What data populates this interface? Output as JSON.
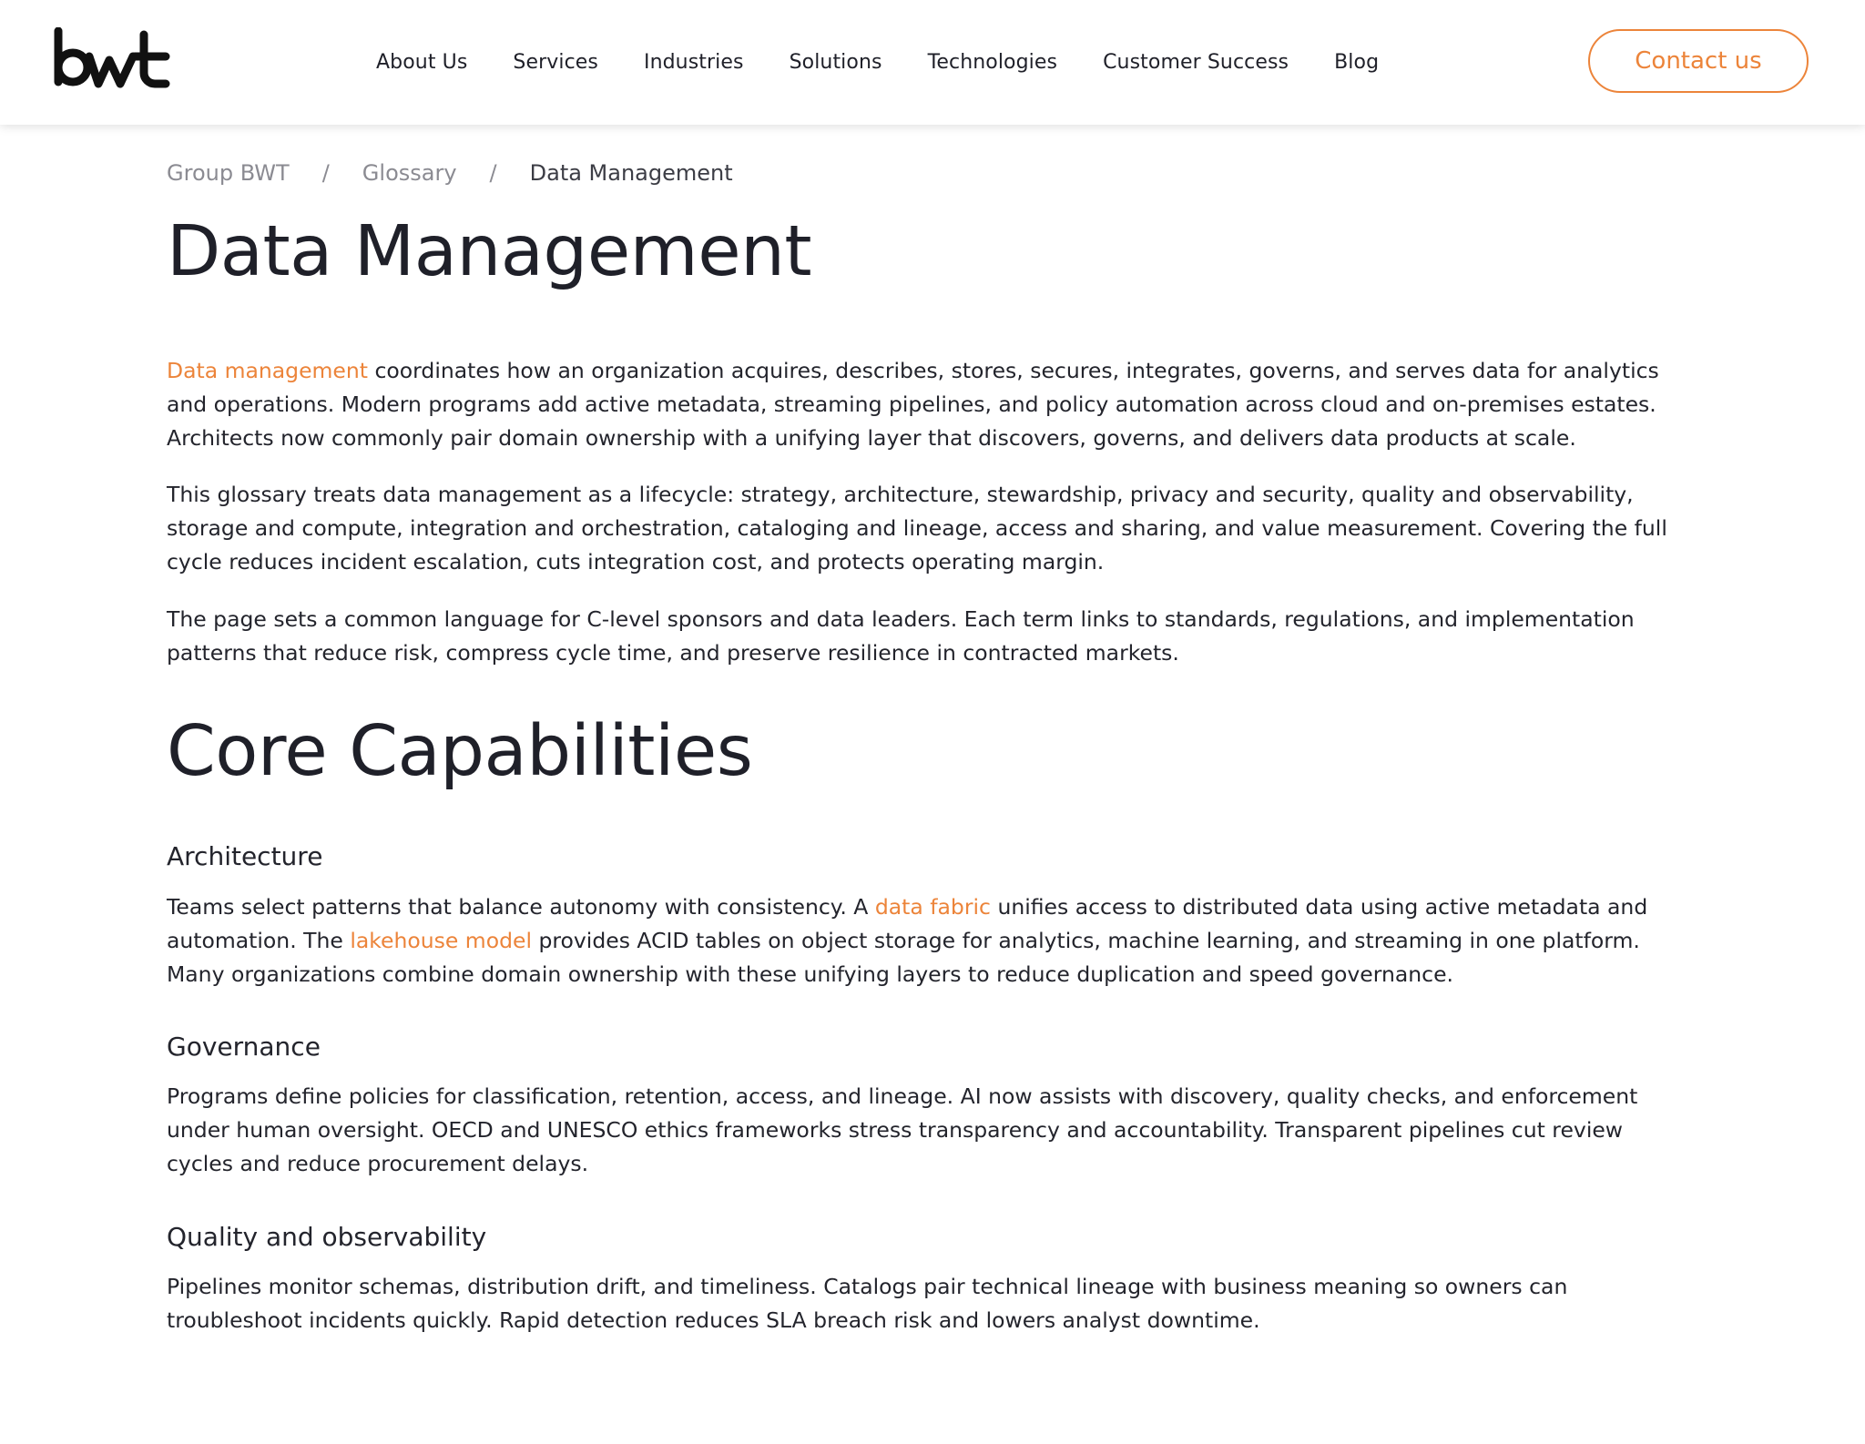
{
  "header": {
    "logo_text": "bwt",
    "nav": [
      "About Us",
      "Services",
      "Industries",
      "Solutions",
      "Technologies",
      "Customer Success",
      "Blog"
    ],
    "contact_label": "Contact us"
  },
  "breadcrumb": {
    "items": [
      "Group BWT",
      "Glossary",
      "Data Management"
    ],
    "separator": "/"
  },
  "title": "Data Management",
  "intro": [
    {
      "link": "Data management",
      "text": " coordinates how an organization acquires, describes, stores, secures, integrates, governs, and serves data for analytics and operations. Modern programs add active metadata, streaming pipelines, and policy automation across cloud and on-premises estates. Architects now commonly pair domain ownership with a unifying layer that discovers, governs, and delivers data products at scale."
    },
    {
      "text": "This glossary treats data management as a lifecycle: strategy, architecture, stewardship, privacy and security, quality and observability, storage and compute, integration and orchestration, cataloging and lineage, access and sharing, and value measurement. Covering the full cycle reduces incident escalation, cuts integration cost, and protects operating margin."
    },
    {
      "text": "The page sets a common language for C-level sponsors and data leaders. Each term links to standards, regulations, and implementation patterns that reduce risk, compress cycle time, and preserve resilience in contracted markets."
    }
  ],
  "core": {
    "title": "Core Capabilities",
    "architecture": {
      "title": "Architecture",
      "t1": "Teams select patterns that balance autonomy with consistency. A ",
      "link1": "data fabric",
      "t2": " unifies access to distributed data using active metadata and automation. The ",
      "link2": "lakehouse model",
      "t3": " provides ACID tables on object storage for analytics, machine learning, and streaming in one platform. Many organizations combine domain ownership with these unifying layers to reduce duplication and speed governance."
    },
    "governance": {
      "title": "Governance",
      "text": "Programs define policies for classification, retention, access, and lineage. AI now assists with discovery, quality checks, and enforcement under human oversight. OECD and UNESCO ethics frameworks stress transparency and accountability. Transparent pipelines cut review cycles and reduce procurement delays."
    },
    "quality": {
      "title": "Quality and observability",
      "text": "Pipelines monitor schemas, distribution drift, and timeliness. Catalogs pair technical lineage with business meaning so owners can troubleshoot incidents quickly. Rapid detection reduces SLA breach risk and lowers analyst downtime."
    }
  },
  "colors": {
    "accent": "#ec843a",
    "text": "#1f2029",
    "muted": "#8b8b92"
  }
}
